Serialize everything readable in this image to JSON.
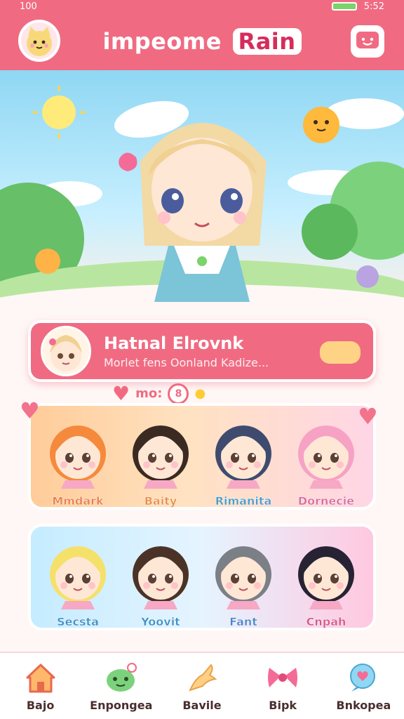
{
  "status": {
    "time_left": "100",
    "time_right": "5:52"
  },
  "header": {
    "title_main": "impeome",
    "title_accent": "Rain"
  },
  "profile": {
    "name": "Hatnal Elrovnk",
    "subtitle": "Morlet fens Oonland Kadize..."
  },
  "section": {
    "label": "mo:",
    "count": "8"
  },
  "characters": [
    {
      "name": "Mmdark",
      "hair": "#f58a3c",
      "color": "#e87f4a"
    },
    {
      "name": "Baity",
      "hair": "#3a2a22",
      "color": "#e88f4a"
    },
    {
      "name": "Rimanita",
      "hair": "#3e4b6e",
      "color": "#4d9bc8"
    },
    {
      "name": "Dornecie",
      "hair": "#f6a2c5",
      "color": "#d96b9c"
    },
    {
      "name": "Secsta",
      "hair": "#f5e06a",
      "color": "#3d90c9"
    },
    {
      "name": "Yoovit",
      "hair": "#4a3326",
      "color": "#3d90c9"
    },
    {
      "name": "Fant",
      "hair": "#7b7f86",
      "color": "#4c87c9"
    },
    {
      "name": "Cnpah",
      "hair": "#272335",
      "color": "#d6588a"
    }
  ],
  "nav": [
    {
      "label": "Bajo",
      "icon": "home-icon"
    },
    {
      "label": "Enpongea",
      "icon": "frog-icon"
    },
    {
      "label": "Bavile",
      "icon": "star-icon"
    },
    {
      "label": "Bipk",
      "icon": "bow-icon"
    },
    {
      "label": "Bnkopea",
      "icon": "chat-icon"
    }
  ],
  "colors": {
    "primary": "#f06b82",
    "accent": "#d52d5b"
  }
}
